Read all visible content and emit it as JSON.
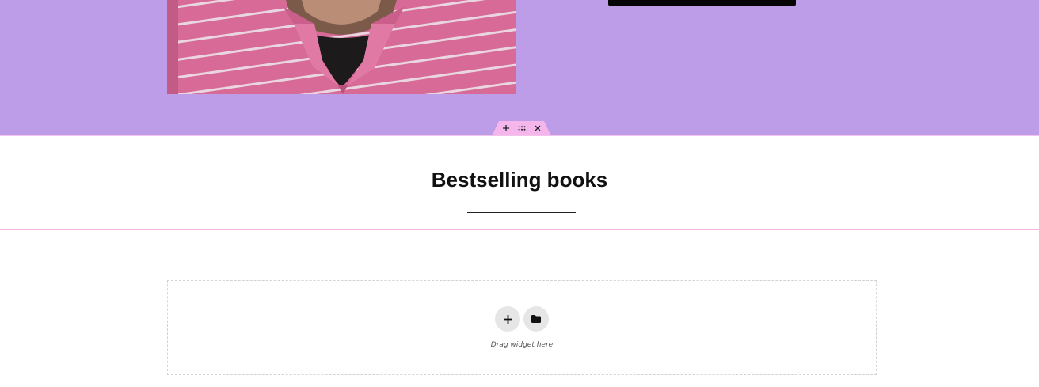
{
  "hero": {
    "photo_alt": "person in pink striped polo shirt",
    "background_color": "#be9de8",
    "button_color": "#050505"
  },
  "section_handle": {
    "add_icon": "plus-icon",
    "drag_icon": "drag-handle-icon",
    "close_icon": "close-icon",
    "color": "#f5b6eb"
  },
  "bestselling": {
    "title": "Bestselling books"
  },
  "drop_zone": {
    "add_icon": "plus-icon",
    "template_icon": "folder-icon",
    "label": "Drag widget here"
  }
}
